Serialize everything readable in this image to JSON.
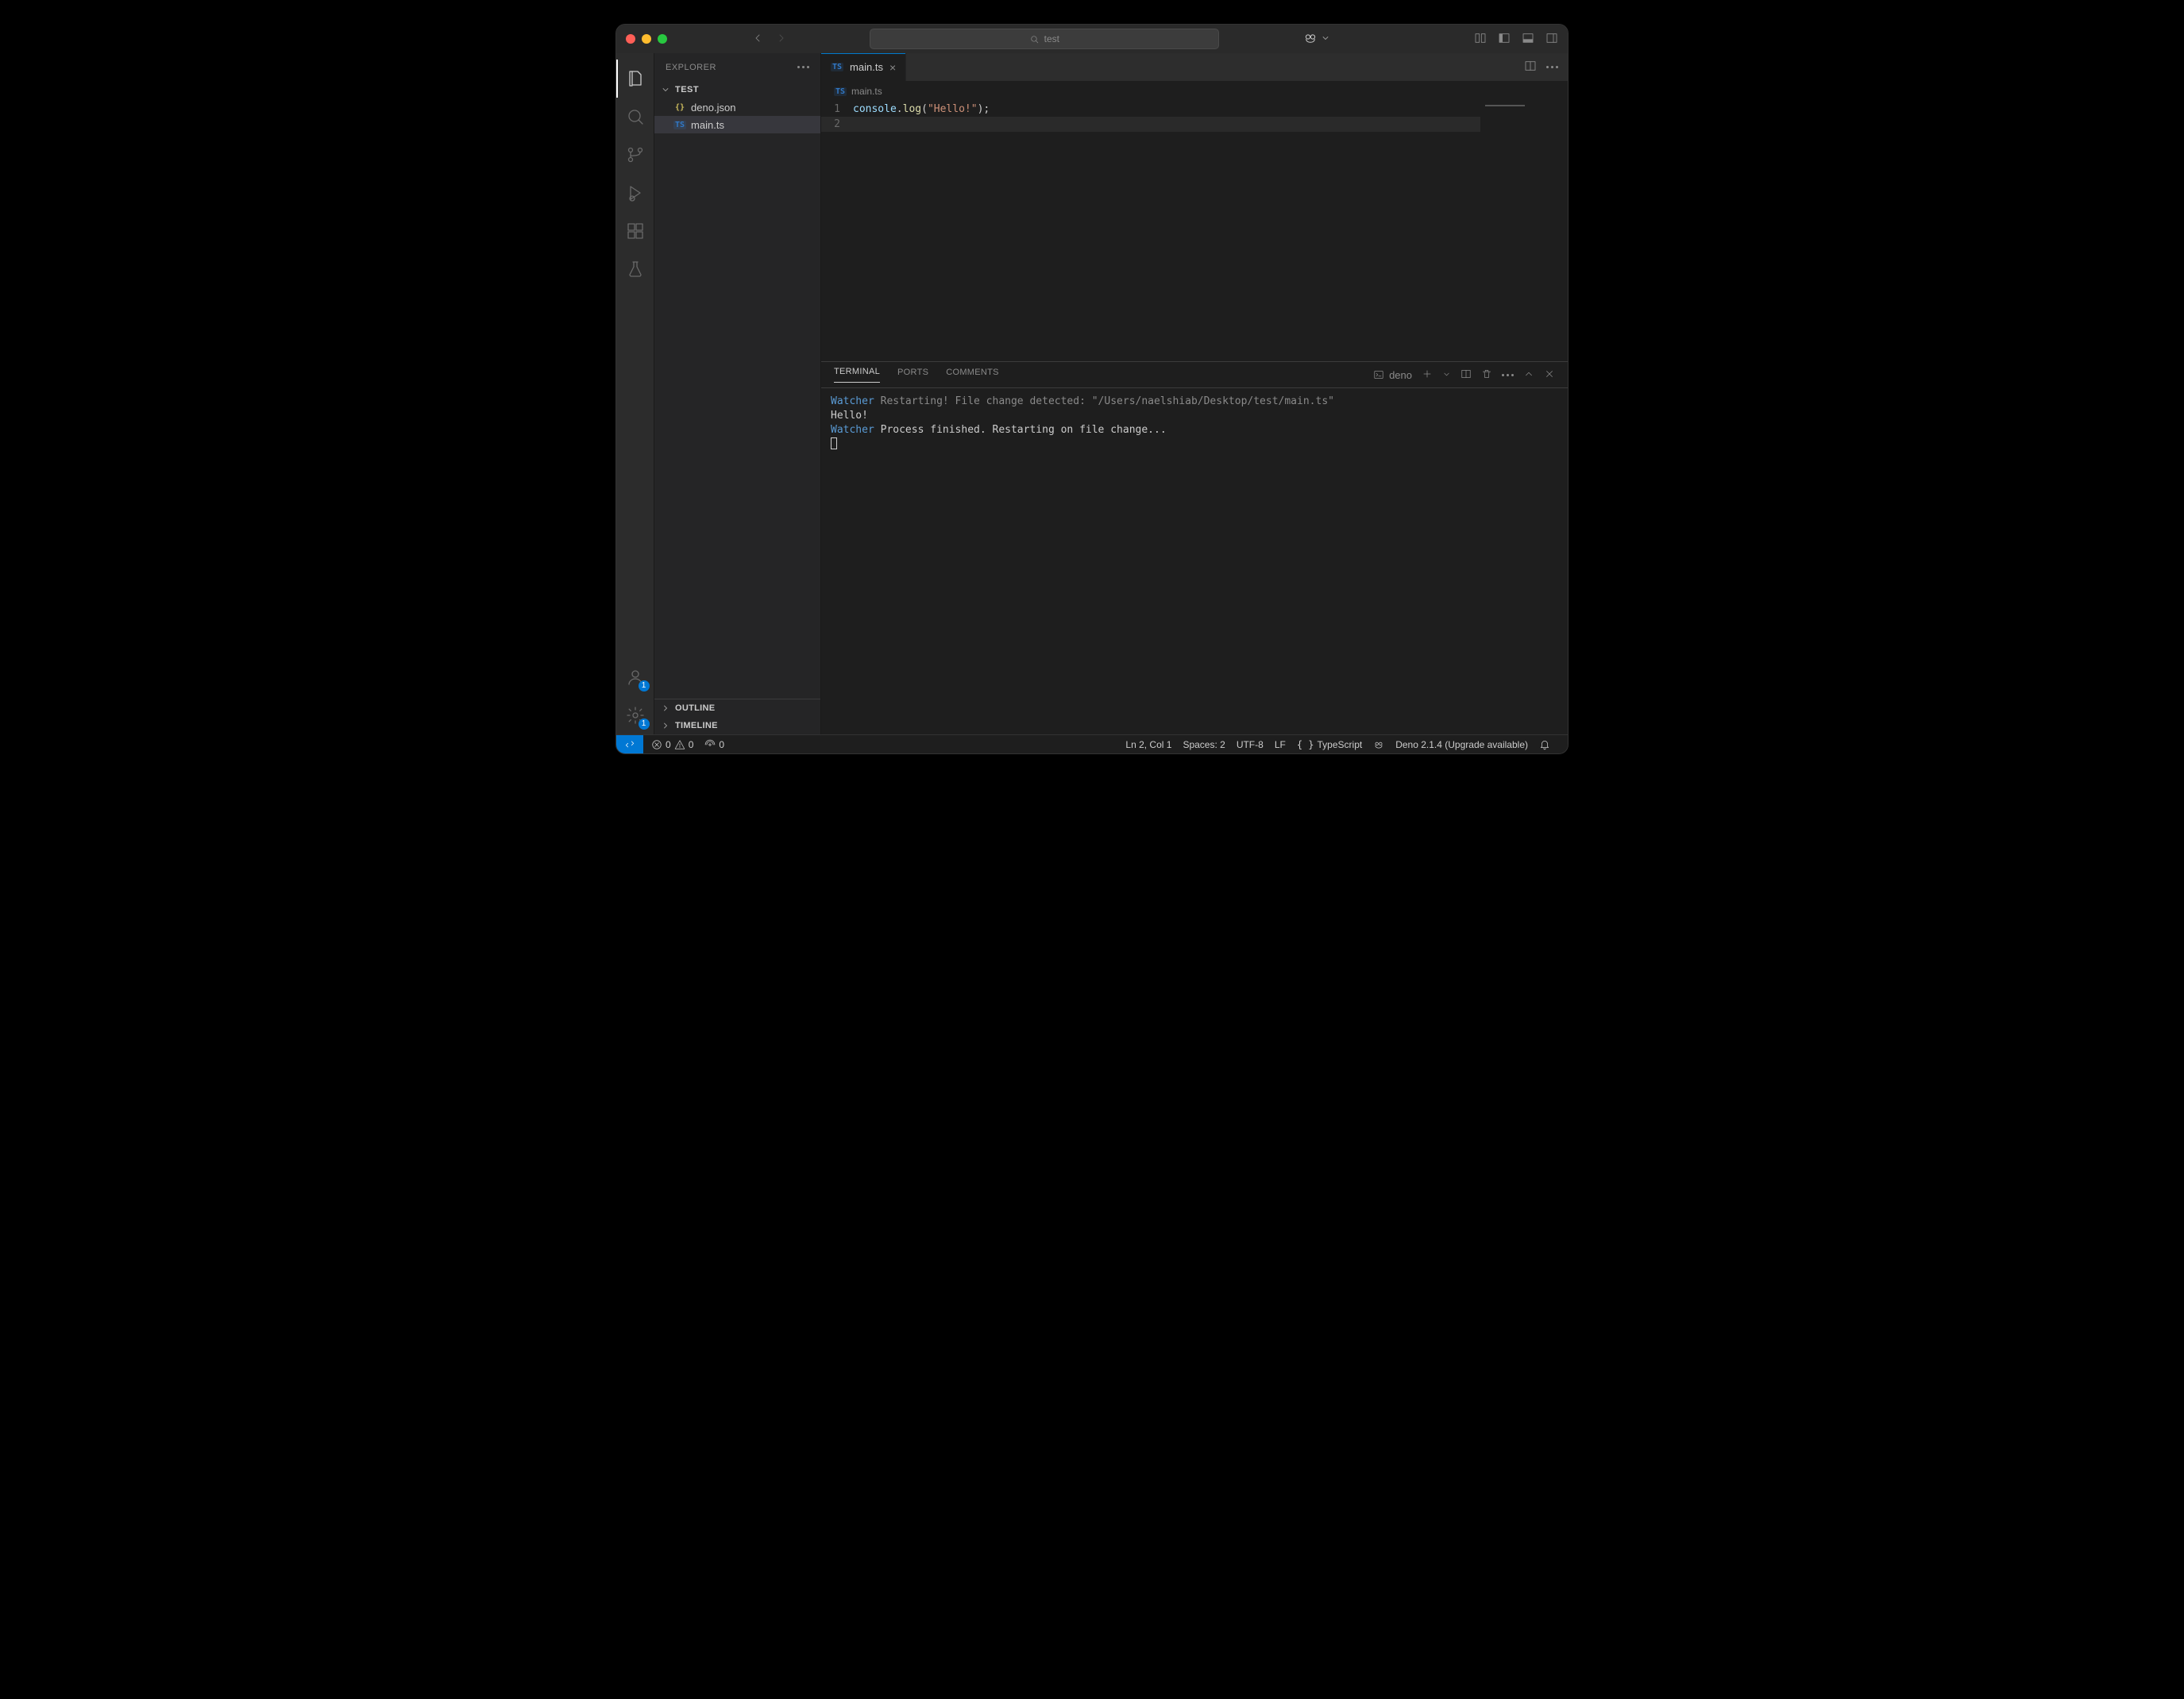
{
  "window": {
    "traffic": {
      "close": "#ff5f57",
      "min": "#febc2e",
      "max": "#28c840"
    }
  },
  "titlebar": {
    "search_text": "test"
  },
  "activitybar": {
    "accounts_badge": "1",
    "settings_badge": "1"
  },
  "explorer": {
    "title": "EXPLORER",
    "folder": "TEST",
    "files": [
      {
        "name": "deno.json",
        "icon": "{}",
        "iconClass": "json",
        "selected": false
      },
      {
        "name": "main.ts",
        "icon": "TS",
        "iconClass": "ts",
        "selected": true
      }
    ],
    "sections": {
      "outline": "OUTLINE",
      "timeline": "TIMELINE"
    }
  },
  "editor": {
    "tab": {
      "icon": "TS",
      "filename": "main.ts"
    },
    "breadcrumb": {
      "icon": "TS",
      "filename": "main.ts"
    },
    "code": {
      "line1": {
        "num": "1",
        "obj": "console",
        "dot": ".",
        "fn": "log",
        "open": "(",
        "str": "\"Hello!\"",
        "close": ");"
      },
      "line2": {
        "num": "2"
      }
    }
  },
  "panel": {
    "tabs": {
      "terminal": "TERMINAL",
      "ports": "PORTS",
      "comments": "COMMENTS"
    },
    "terminal": {
      "shell": "deno",
      "lines": {
        "l1_prefix": "Watcher",
        "l1_rest": " Restarting! File change detected: \"/Users/naelshiab/Desktop/test/main.ts\"",
        "l2": "Hello!",
        "l3_prefix": "Watcher",
        "l3_rest": " Process finished. Restarting on file change..."
      }
    }
  },
  "status": {
    "errors": "0",
    "warnings": "0",
    "ports": "0",
    "cursor": "Ln 2, Col 1",
    "spaces": "Spaces: 2",
    "encoding": "UTF-8",
    "eol": "LF",
    "lang": "TypeScript",
    "runtime": "Deno 2.1.4 (Upgrade available)"
  }
}
